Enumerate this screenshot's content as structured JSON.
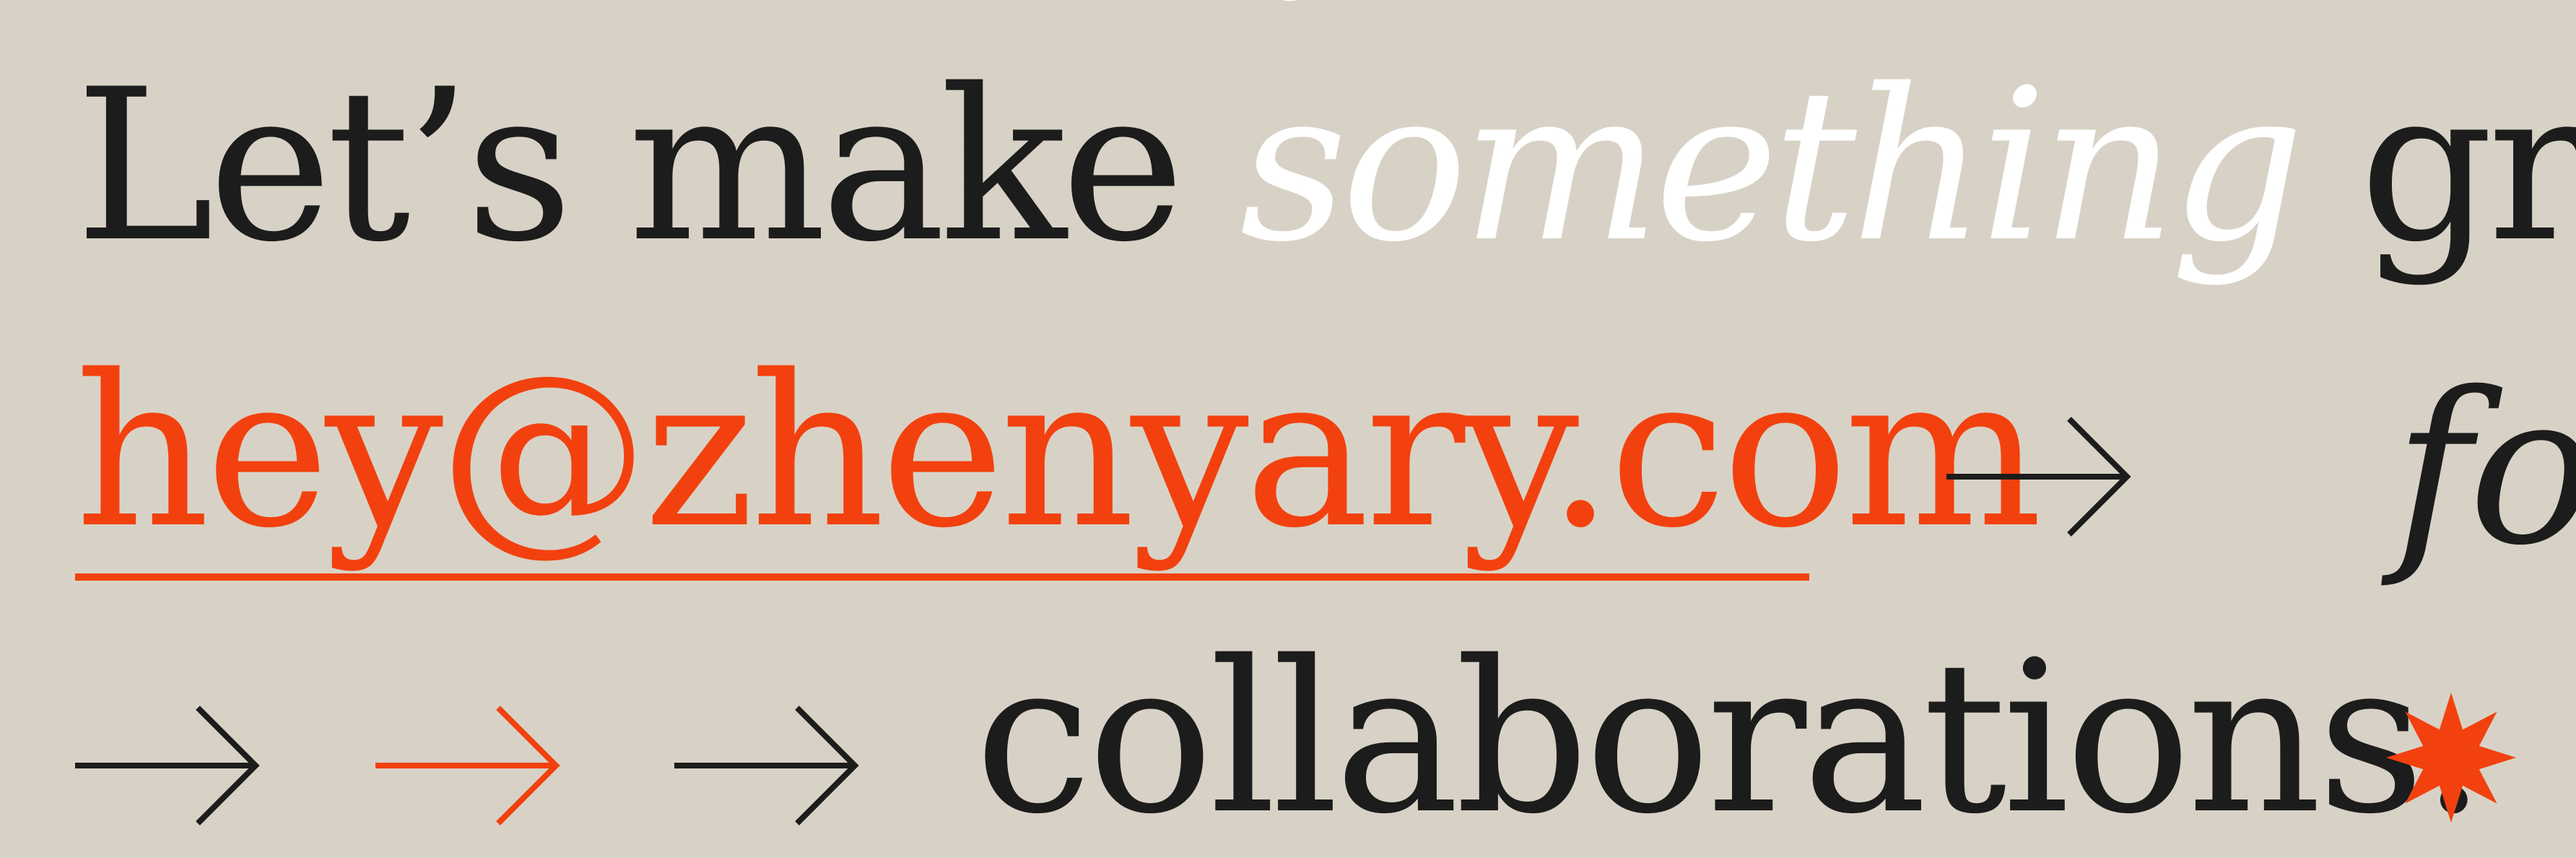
{
  "colors": {
    "background": "#d8d2c6",
    "text": "#1c1c1c",
    "accent": "#f2410e",
    "highlight": "#ffffff"
  },
  "headline": {
    "before": "Let’s make ",
    "accent": "something",
    "after": " great!"
  },
  "contact": {
    "email": "hey@zhenyary.com",
    "arrow_icon": "arrow-right-icon",
    "suffix": "for"
  },
  "closing": {
    "arrow_icons": [
      "arrow-right-icon",
      "arrow-right-icon",
      "arrow-right-icon"
    ],
    "word": "collaborations.",
    "star_icon": "starburst-icon"
  }
}
